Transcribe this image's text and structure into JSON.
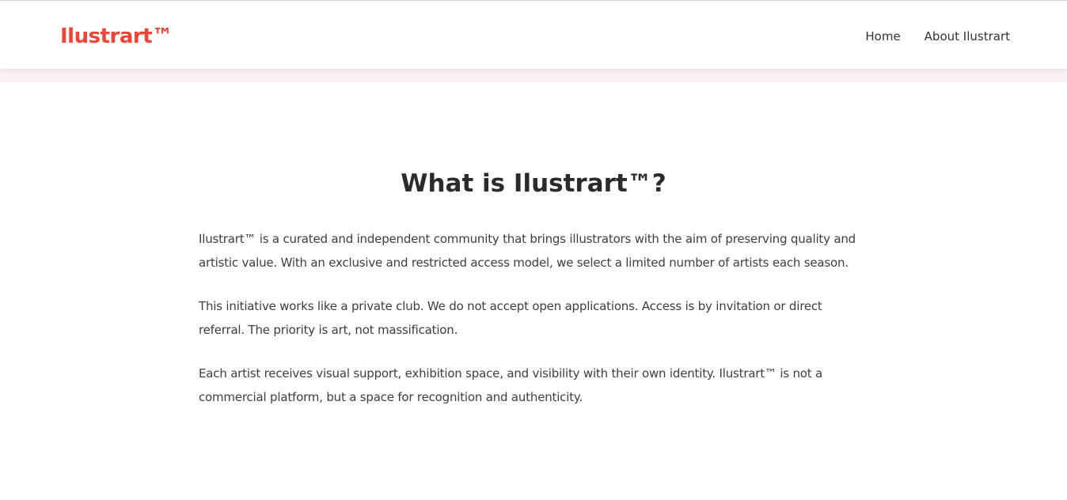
{
  "header": {
    "logo": "Ilustrart™",
    "nav": [
      {
        "label": "Home"
      },
      {
        "label": "About Ilustrart"
      }
    ]
  },
  "main": {
    "title": "What is Ilustrart™?",
    "paragraphs": [
      "Ilustrart™ is a curated and independent community that brings illustrators with the aim of preserving quality and artistic value. With an exclusive and restricted access model, we select a limited number of artists each season.",
      "This initiative works like a private club. We do not accept open applications. Access is by invitation or direct referral. The priority is art, not massification.",
      "Each artist receives visual support, exhibition space, and visibility with their own identity. Ilustrart™ is not a commercial platform, but a space for recognition and authenticity."
    ]
  },
  "colors": {
    "brand": "#f04438",
    "text": "#333333",
    "band": "#fbf1f2"
  }
}
